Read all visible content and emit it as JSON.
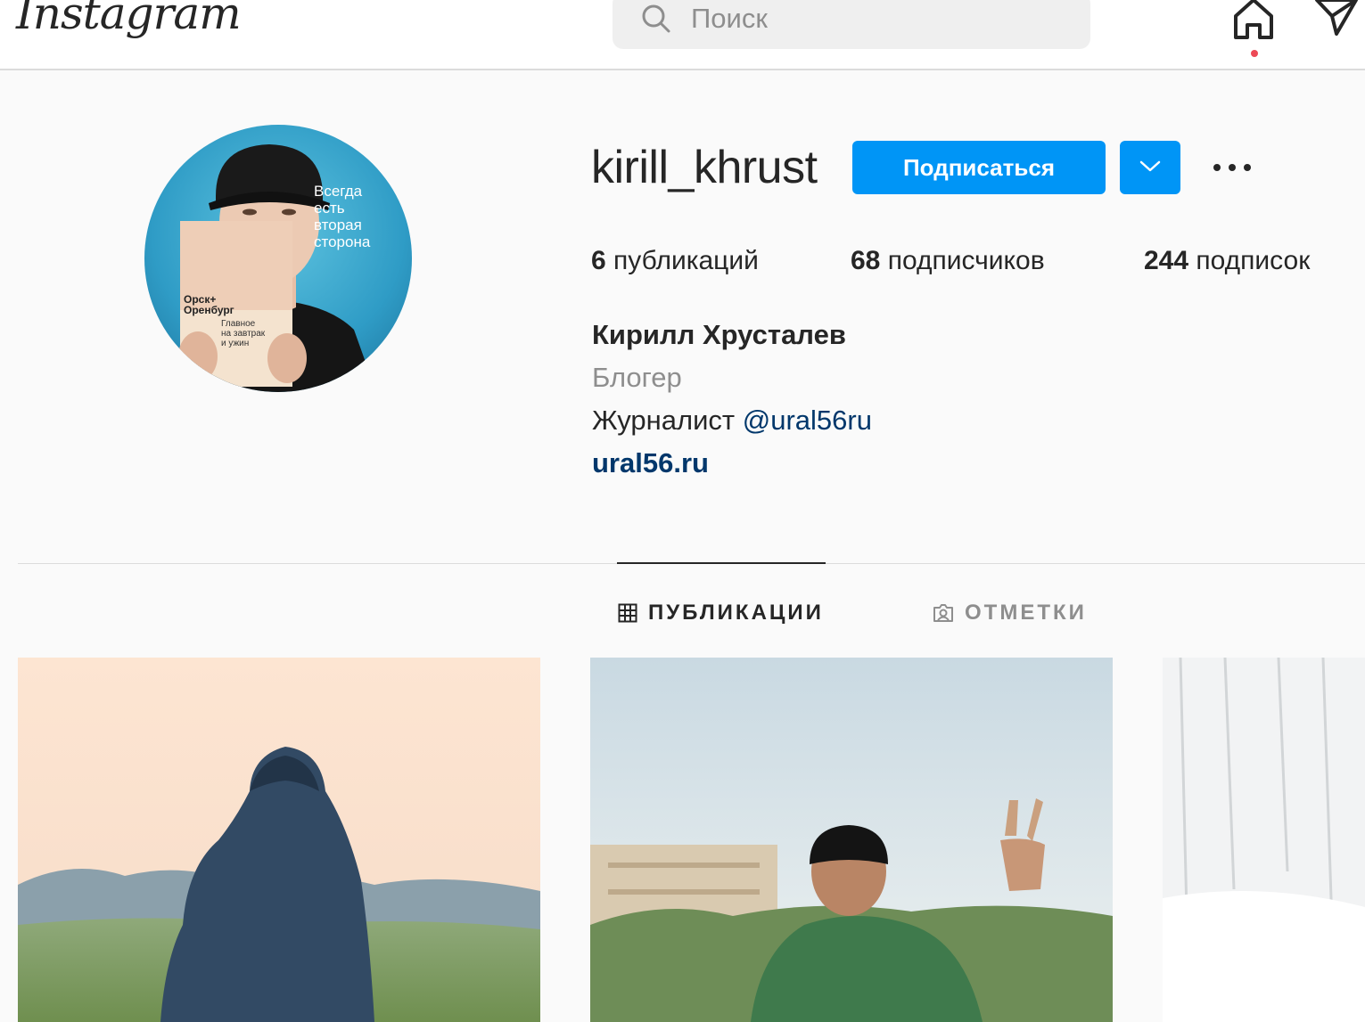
{
  "header": {
    "logo": "Instagram",
    "search_placeholder": "Поиск",
    "icons": [
      "search-icon",
      "home-icon",
      "direct-icon"
    ]
  },
  "profile": {
    "username": "kirill_khrust",
    "follow_label": "Подписаться",
    "stats": {
      "posts_count": "6",
      "posts_label": "публикаций",
      "followers_count": "68",
      "followers_label": "подписчиков",
      "following_count": "244",
      "following_label": "подписок"
    },
    "full_name": "Кирилл Хрусталев",
    "category": "Блогер",
    "bio_text": "Журналист",
    "bio_mention": "@ural56ru",
    "website": "ural56.ru",
    "avatar_text": {
      "headline_1": "Всегда",
      "headline_2": "есть",
      "headline_3": "вторая",
      "headline_4": "сторона",
      "cover_1": "Орск+",
      "cover_2": "Оренбург",
      "cover_3": "Главное",
      "cover_4": "на завтрак",
      "cover_5": "и ужин"
    }
  },
  "tabs": [
    {
      "label": "ПУБЛИКАЦИИ",
      "active": true
    },
    {
      "label": "ОТМЕТКИ",
      "active": false
    }
  ],
  "colors": {
    "accent": "#0095f6",
    "link": "#00376b",
    "notification": "#ed4956"
  }
}
